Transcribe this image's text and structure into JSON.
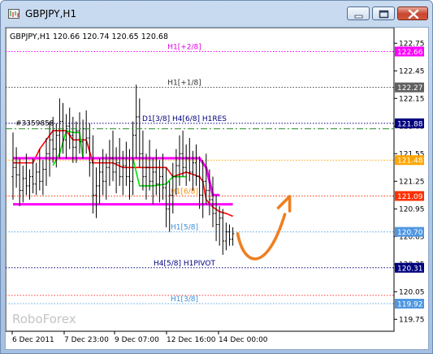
{
  "window": {
    "title": "GBPJPY,H1",
    "buttons": [
      "minimize",
      "maximize",
      "close"
    ],
    "icon": "chart-window-icon"
  },
  "chart_data": {
    "type": "bar",
    "header": "GBPJPY,H1  120.66 120.74 120.65 120.68",
    "symbol": "GBPJPY,H1",
    "ohlc": {
      "open": 120.66,
      "high": 120.74,
      "low": 120.65,
      "close": 120.68
    },
    "watermark": "RoboForex",
    "ylim": [
      119.62,
      122.92
    ],
    "y_ticks": [
      122.75,
      122.45,
      122.15,
      121.85,
      121.55,
      121.25,
      120.95,
      120.65,
      120.35,
      120.05,
      119.75
    ],
    "x_ticks": [
      "6 Dec 2011",
      "7 Dec 23:00",
      "9 Dec 07:00",
      "12 Dec 16:00",
      "14 Dec 00:00"
    ],
    "grid": false,
    "levels": [
      {
        "label": "H1[+2/8]",
        "price": 122.66,
        "price_label": "122.66",
        "color": "#ff00ff",
        "label_color": "#e000e0",
        "tag_color": "#ff00ff",
        "style": "dot"
      },
      {
        "label": "H1[+1/8]",
        "price": 122.27,
        "price_label": "122.27",
        "color": "#404040",
        "label_color": "#303030",
        "tag_color": "#606060",
        "style": "dot"
      },
      {
        "label": "D1[3/8] H4[6/8] H1RES",
        "price": 121.88,
        "price_label": "121.88",
        "color": "#000080",
        "label_color": "#000080",
        "tag_color": "#000080",
        "style": "dot"
      },
      {
        "label": "",
        "price": 121.48,
        "price_label": "121.48",
        "color": "#ffa500",
        "label_color": "#ffa500",
        "tag_color": "#ffa500",
        "style": "dot"
      },
      {
        "label": "",
        "price": 121.09,
        "price_label": "121.09",
        "color": "#ff3000",
        "label_color": "#ff3000",
        "tag_color": "#ff3000",
        "style": "dot"
      },
      {
        "label": "H1[6/8]",
        "price": 121.09,
        "price_label": "",
        "color": "none",
        "label_color": "#ff8c00",
        "tag_color": "none",
        "style": "none"
      },
      {
        "label": "H1[5/8]",
        "price": 120.7,
        "price_label": "120.70",
        "color": "#5aa7e6",
        "label_color": "#3d8fd6",
        "tag_color": "#4f97e2",
        "style": "dot"
      },
      {
        "label": "H4[5/8] H1PIVOT",
        "price": 120.31,
        "price_label": "120.31",
        "color": "#000080",
        "label_color": "#000080",
        "tag_color": "#000080",
        "style": "dot"
      },
      {
        "label": "",
        "price": 120.01,
        "price_label": "",
        "color": "#ff4040",
        "label_color": "#ff4040",
        "tag_color": "none",
        "style": "dot"
      },
      {
        "label": "H1[3/8]",
        "price": 119.92,
        "price_label": "119.92",
        "color": "#5aa7e6",
        "label_color": "#3d8fd6",
        "tag_color": "#4f97e2",
        "style": "dot"
      }
    ],
    "trade_label": "#3359858",
    "trade_level": 121.82,
    "magenta_band": {
      "upper": 121.5,
      "lower": 121.0
    },
    "forecast": {
      "from_price": 120.68,
      "to_price": 121.05,
      "direction": "up"
    },
    "bars": [
      {
        "o": 121.3,
        "h": 121.78,
        "l": 121.05,
        "c": 121.4
      },
      {
        "o": 121.4,
        "h": 121.62,
        "l": 121.18,
        "c": 121.32
      },
      {
        "o": 121.32,
        "h": 121.5,
        "l": 120.98,
        "c": 121.15
      },
      {
        "o": 121.15,
        "h": 121.42,
        "l": 121.02,
        "c": 121.28
      },
      {
        "o": 121.28,
        "h": 121.55,
        "l": 121.1,
        "c": 121.2
      },
      {
        "o": 121.2,
        "h": 121.38,
        "l": 121.05,
        "c": 121.3
      },
      {
        "o": 121.3,
        "h": 121.5,
        "l": 121.12,
        "c": 121.22
      },
      {
        "o": 121.22,
        "h": 121.45,
        "l": 121.1,
        "c": 121.35
      },
      {
        "o": 121.35,
        "h": 121.6,
        "l": 121.15,
        "c": 121.25
      },
      {
        "o": 121.25,
        "h": 121.48,
        "l": 121.1,
        "c": 121.38
      },
      {
        "o": 121.38,
        "h": 121.72,
        "l": 121.2,
        "c": 121.55
      },
      {
        "o": 121.55,
        "h": 121.9,
        "l": 121.3,
        "c": 121.7
      },
      {
        "o": 121.7,
        "h": 121.95,
        "l": 121.45,
        "c": 121.6
      },
      {
        "o": 121.6,
        "h": 121.88,
        "l": 121.4,
        "c": 121.75
      },
      {
        "o": 121.75,
        "h": 122.15,
        "l": 121.5,
        "c": 121.9
      },
      {
        "o": 121.9,
        "h": 122.1,
        "l": 121.55,
        "c": 121.7
      },
      {
        "o": 121.7,
        "h": 121.98,
        "l": 121.5,
        "c": 121.85
      },
      {
        "o": 121.85,
        "h": 122.05,
        "l": 121.6,
        "c": 121.75
      },
      {
        "o": 121.75,
        "h": 121.95,
        "l": 121.45,
        "c": 121.62
      },
      {
        "o": 121.62,
        "h": 121.9,
        "l": 121.45,
        "c": 121.8
      },
      {
        "o": 121.8,
        "h": 122.0,
        "l": 121.55,
        "c": 121.68
      },
      {
        "o": 121.68,
        "h": 121.92,
        "l": 121.5,
        "c": 121.82
      },
      {
        "o": 121.82,
        "h": 122.02,
        "l": 121.55,
        "c": 121.72
      },
      {
        "o": 121.72,
        "h": 121.88,
        "l": 121.3,
        "c": 121.45
      },
      {
        "o": 121.45,
        "h": 121.75,
        "l": 120.9,
        "c": 121.1
      },
      {
        "o": 121.1,
        "h": 121.4,
        "l": 120.85,
        "c": 121.2
      },
      {
        "o": 121.2,
        "h": 121.5,
        "l": 121.0,
        "c": 121.35
      },
      {
        "o": 121.35,
        "h": 121.6,
        "l": 121.1,
        "c": 121.25
      },
      {
        "o": 121.25,
        "h": 121.55,
        "l": 121.05,
        "c": 121.4
      },
      {
        "o": 121.4,
        "h": 121.7,
        "l": 121.2,
        "c": 121.5
      },
      {
        "o": 121.5,
        "h": 121.8,
        "l": 121.25,
        "c": 121.35
      },
      {
        "o": 121.35,
        "h": 121.62,
        "l": 121.12,
        "c": 121.45
      },
      {
        "o": 121.45,
        "h": 121.72,
        "l": 121.2,
        "c": 121.3
      },
      {
        "o": 121.3,
        "h": 121.58,
        "l": 121.1,
        "c": 121.42
      },
      {
        "o": 121.42,
        "h": 121.68,
        "l": 121.2,
        "c": 121.3
      },
      {
        "o": 121.3,
        "h": 121.6,
        "l": 121.05,
        "c": 121.25
      },
      {
        "o": 121.25,
        "h": 121.9,
        "l": 121.1,
        "c": 121.75
      },
      {
        "o": 121.75,
        "h": 122.3,
        "l": 121.5,
        "c": 121.95
      },
      {
        "o": 121.95,
        "h": 122.15,
        "l": 121.4,
        "c": 121.55
      },
      {
        "o": 121.55,
        "h": 121.8,
        "l": 121.15,
        "c": 121.3
      },
      {
        "o": 121.3,
        "h": 121.55,
        "l": 121.05,
        "c": 121.4
      },
      {
        "o": 121.4,
        "h": 121.7,
        "l": 121.15,
        "c": 121.25
      },
      {
        "o": 121.25,
        "h": 121.5,
        "l": 121.0,
        "c": 121.35
      },
      {
        "o": 121.35,
        "h": 121.6,
        "l": 121.1,
        "c": 121.22
      },
      {
        "o": 121.22,
        "h": 121.48,
        "l": 121.02,
        "c": 121.3
      },
      {
        "o": 121.3,
        "h": 121.55,
        "l": 121.05,
        "c": 121.18
      },
      {
        "o": 121.18,
        "h": 121.4,
        "l": 120.75,
        "c": 120.95
      },
      {
        "o": 120.95,
        "h": 121.25,
        "l": 120.7,
        "c": 121.1
      },
      {
        "o": 121.1,
        "h": 121.45,
        "l": 120.9,
        "c": 121.3
      },
      {
        "o": 121.3,
        "h": 121.6,
        "l": 121.1,
        "c": 121.42
      },
      {
        "o": 121.42,
        "h": 121.75,
        "l": 121.2,
        "c": 121.55
      },
      {
        "o": 121.55,
        "h": 121.8,
        "l": 121.3,
        "c": 121.4
      },
      {
        "o": 121.4,
        "h": 121.65,
        "l": 121.2,
        "c": 121.5
      },
      {
        "o": 121.5,
        "h": 121.72,
        "l": 121.25,
        "c": 121.35
      },
      {
        "o": 121.35,
        "h": 121.58,
        "l": 121.15,
        "c": 121.45
      },
      {
        "o": 121.45,
        "h": 121.65,
        "l": 121.2,
        "c": 121.3
      },
      {
        "o": 121.3,
        "h": 121.52,
        "l": 120.95,
        "c": 121.1
      },
      {
        "o": 121.1,
        "h": 121.48,
        "l": 120.85,
        "c": 121.25
      },
      {
        "o": 121.25,
        "h": 121.55,
        "l": 121.0,
        "c": 121.15
      },
      {
        "o": 121.15,
        "h": 121.38,
        "l": 120.88,
        "c": 121.05
      },
      {
        "o": 121.05,
        "h": 121.3,
        "l": 120.75,
        "c": 120.9
      },
      {
        "o": 120.9,
        "h": 121.1,
        "l": 120.6,
        "c": 120.78
      },
      {
        "o": 120.78,
        "h": 120.98,
        "l": 120.55,
        "c": 120.85
      },
      {
        "o": 120.85,
        "h": 120.95,
        "l": 120.45,
        "c": 120.6
      },
      {
        "o": 120.6,
        "h": 120.8,
        "l": 120.5,
        "c": 120.7
      },
      {
        "o": 120.7,
        "h": 120.78,
        "l": 120.55,
        "c": 120.62
      },
      {
        "o": 120.62,
        "h": 120.75,
        "l": 120.55,
        "c": 120.68
      }
    ],
    "overlays": [
      {
        "name": "",
        "color": "#ff0000",
        "points": [
          [
            0,
            121.45
          ],
          [
            6,
            121.45
          ],
          [
            8,
            121.6
          ],
          [
            12,
            121.8
          ],
          [
            16,
            121.8
          ],
          [
            18,
            121.7
          ],
          [
            22,
            121.7
          ],
          [
            24,
            121.45
          ],
          [
            30,
            121.45
          ],
          [
            33,
            121.4
          ],
          [
            37,
            121.4
          ],
          [
            42,
            121.4
          ],
          [
            46,
            121.4
          ],
          [
            48,
            121.3
          ],
          [
            52,
            121.35
          ],
          [
            56,
            121.3
          ],
          [
            57,
            121.25
          ],
          [
            58,
            121.05
          ],
          [
            60,
            120.97
          ],
          [
            62,
            120.92
          ],
          [
            64,
            120.9
          ],
          [
            66,
            120.87
          ]
        ]
      },
      {
        "name": "",
        "color": "#00e000",
        "points": [
          [
            12,
            121.42
          ],
          [
            14,
            121.55
          ],
          [
            16,
            121.8
          ],
          [
            18,
            121.78
          ],
          [
            20,
            121.78
          ],
          [
            21,
            121.5
          ],
          [
            36,
            121.5
          ],
          [
            38,
            121.2
          ],
          [
            42,
            121.2
          ],
          [
            46,
            121.22
          ],
          [
            48,
            121.3
          ],
          [
            52,
            121.3
          ]
        ]
      },
      {
        "name": "",
        "color": "#ff00ff",
        "points": [
          [
            0,
            121.5
          ],
          [
            56,
            121.5
          ],
          [
            58,
            121.4
          ],
          [
            60,
            121.1
          ],
          [
            62,
            121.1
          ]
        ]
      },
      {
        "name": "",
        "color": "#ff00ff",
        "points": [
          [
            0,
            121.0
          ],
          [
            66,
            121.0
          ]
        ]
      }
    ]
  }
}
